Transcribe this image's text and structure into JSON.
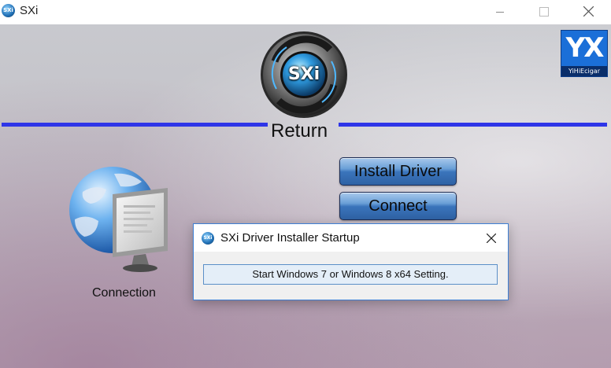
{
  "window": {
    "title": "SXi",
    "icon_text": "SXi"
  },
  "main": {
    "logo_text": "SXi",
    "return_label": "Return",
    "brand_logo": {
      "glyph": "YX",
      "caption": "YiHiEcigar"
    },
    "connection_label": "Connection",
    "install_driver_label": "Install Driver",
    "connect_label": "Connect"
  },
  "dialog": {
    "title": "SXi Driver Installer Startup",
    "icon_text": "SXi",
    "button_label": "Start Windows 7 or Windows 8 x64 Setting."
  },
  "colors": {
    "accent_line": "#2e35e8",
    "button_blue": "#3a74bb",
    "dialog_border": "#3d7fd4"
  }
}
